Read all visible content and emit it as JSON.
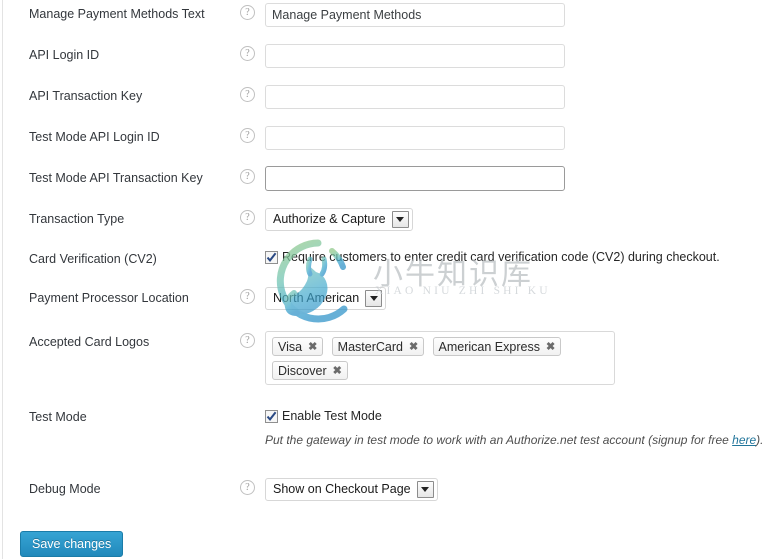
{
  "form": {
    "rows": [
      {
        "label": "Manage Payment Methods Text",
        "help": "?",
        "control": "text",
        "value": "Manage Payment Methods",
        "placeholder": ""
      },
      {
        "label": "API Login ID",
        "help": "?",
        "control": "text",
        "value": "",
        "placeholder": ""
      },
      {
        "label": "API Transaction Key",
        "help": "?",
        "control": "text",
        "value": "",
        "placeholder": ""
      },
      {
        "label": "Test Mode API Login ID",
        "help": "?",
        "control": "text",
        "value": "",
        "placeholder": ""
      },
      {
        "label": "Test Mode API Transaction Key",
        "help": "?",
        "control": "text",
        "value": "",
        "placeholder": ""
      },
      {
        "label": "Transaction Type",
        "help": "?",
        "control": "select",
        "value": "Authorize & Capture"
      },
      {
        "label": "Card Verification (CV2)",
        "help": "",
        "control": "checkbox",
        "checked": true,
        "checkbox_label": "Require customers to enter credit card verification code (CV2) during checkout."
      },
      {
        "label": "Payment Processor Location",
        "help": "?",
        "control": "select",
        "value": "North American"
      },
      {
        "label": "Accepted Card Logos",
        "help": "?",
        "control": "tags",
        "tags": [
          "Visa",
          "MasterCard",
          "American Express",
          "Discover"
        ],
        "tag_remove_glyph": "✖"
      },
      {
        "label": "Test Mode",
        "help": "",
        "control": "checkbox",
        "checked": true,
        "checkbox_label": "Enable Test Mode",
        "hint_before": "Put the gateway in test mode to work with an Authorize.net test account (signup for free ",
        "hint_link": "here",
        "hint_after": ")."
      },
      {
        "label": "Debug Mode",
        "help": "?",
        "control": "select",
        "value": "Show on Checkout Page"
      }
    ],
    "save_label": "Save changes"
  },
  "watermark": {
    "chinese": "小牛知识库",
    "pinyin": "XIAO NIU ZHI SHI KU"
  },
  "colors": {
    "accent": "#2189bb",
    "link": "#21759b",
    "label": "#33373c",
    "border": "#dcdcdc"
  }
}
